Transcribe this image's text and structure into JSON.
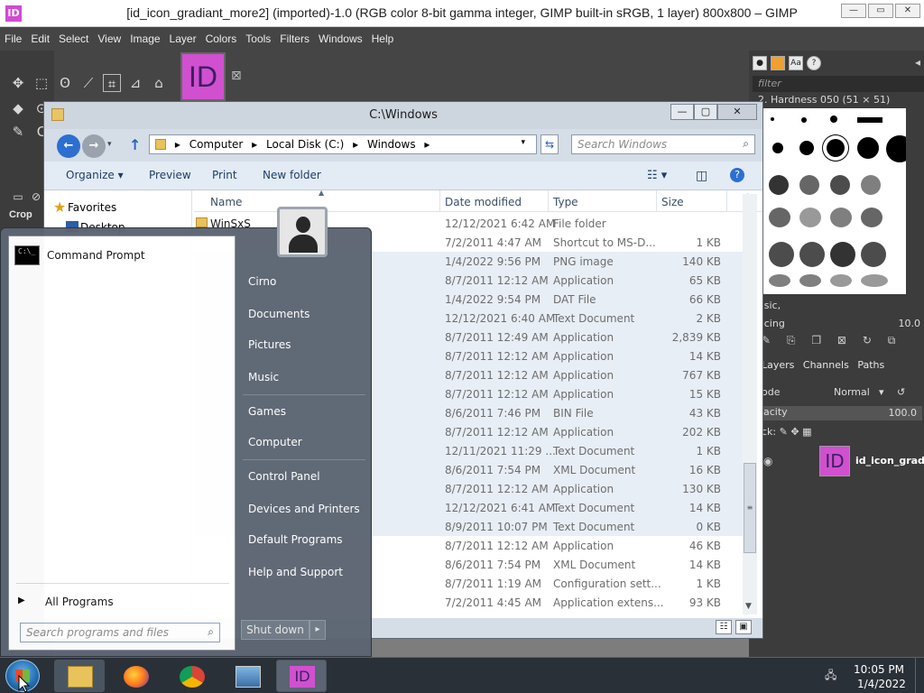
{
  "gimp": {
    "title": "[id_icon_gradiant_more2] (imported)-1.0 (RGB color 8-bit gamma integer, GIMP built-in sRGB, 1 layer) 800x800 – GIMP",
    "app_icon": "ID",
    "menu": [
      "File",
      "Edit",
      "Select",
      "View",
      "Image",
      "Layer",
      "Colors",
      "Tools",
      "Filters",
      "Windows",
      "Help"
    ],
    "crop_label": "Crop",
    "image_tab": "ID",
    "dock": {
      "filter_placeholder": "filter",
      "brush_name": "2. Hardness 050 (51 × 51)",
      "brush_mode": "asic,",
      "spacing_label": "acing",
      "spacing_value": "10.0",
      "tabs": [
        "Layers",
        "Channels",
        "Paths"
      ],
      "mode_label": "ode",
      "mode_value": "Normal",
      "opacity_label": "acity",
      "opacity_value": "100.0",
      "lock_label": "ck:",
      "layer_name": "id_icon_gradi",
      "layer_thumb": "ID"
    }
  },
  "explorer": {
    "title": "C:\\Windows",
    "breadcrumb": [
      "Computer",
      "Local Disk (C:)",
      "Windows"
    ],
    "search_placeholder": "Search Windows",
    "commands": [
      "Organize ▾",
      "Preview",
      "Print",
      "New folder"
    ],
    "nav": {
      "favorites": "Favorites",
      "desktop": "Desktop"
    },
    "columns": [
      "Name",
      "Date modified",
      "Type",
      "Size"
    ],
    "rows": [
      {
        "name": "WinSxS",
        "date": "12/12/2021 6:42 AM",
        "type": "File folder",
        "size": "",
        "folder": true
      },
      {
        "name": "",
        "date": "7/2/2011 4:47 AM",
        "type": "Shortcut to MS-D...",
        "size": "1 KB"
      },
      {
        "name": "",
        "date": "1/4/2022 9:56 PM",
        "type": "PNG image",
        "size": "140 KB"
      },
      {
        "name": "",
        "date": "8/7/2011 12:12 AM",
        "type": "Application",
        "size": "65 KB"
      },
      {
        "name": "",
        "date": "1/4/2022 9:54 PM",
        "type": "DAT File",
        "size": "66 KB"
      },
      {
        "name": "",
        "date": "12/12/2021 6:40 AM",
        "type": "Text Document",
        "size": "2 KB"
      },
      {
        "name": "",
        "date": "8/7/2011 12:49 AM",
        "type": "Application",
        "size": "2,839 KB"
      },
      {
        "name": "",
        "date": "8/7/2011 12:12 AM",
        "type": "Application",
        "size": "14 KB"
      },
      {
        "name": "",
        "date": "8/7/2011 12:12 AM",
        "type": "Application",
        "size": "767 KB"
      },
      {
        "name": "",
        "date": "8/7/2011 12:12 AM",
        "type": "Application",
        "size": "15 KB"
      },
      {
        "name": "",
        "date": "8/6/2011 7:46 PM",
        "type": "BIN File",
        "size": "43 KB"
      },
      {
        "name": "",
        "date": "8/7/2011 12:12 AM",
        "type": "Application",
        "size": "202 KB"
      },
      {
        "name": "",
        "date": "12/11/2021 11:29 ...",
        "type": "Text Document",
        "size": "1 KB"
      },
      {
        "name": "",
        "date": "8/6/2011 7:54 PM",
        "type": "XML Document",
        "size": "16 KB"
      },
      {
        "name": "",
        "date": "8/7/2011 12:12 AM",
        "type": "Application",
        "size": "130 KB"
      },
      {
        "name": "",
        "date": "12/12/2021 6:41 AM",
        "type": "Text Document",
        "size": "14 KB"
      },
      {
        "name": "",
        "date": "8/9/2011 10:07 PM",
        "type": "Text Document",
        "size": "0 KB"
      },
      {
        "name": "",
        "date": "8/7/2011 12:12 AM",
        "type": "Application",
        "size": "46 KB"
      },
      {
        "name": "",
        "date": "8/6/2011 7:54 PM",
        "type": "XML Document",
        "size": "14 KB"
      },
      {
        "name": "",
        "date": "8/7/2011 1:19 AM",
        "type": "Configuration sett...",
        "size": "1 KB"
      },
      {
        "name": "",
        "date": "7/2/2011 4:45 AM",
        "type": "Application extens...",
        "size": "93 KB"
      }
    ]
  },
  "start_menu": {
    "pinned": [
      {
        "label": "Command Prompt",
        "icon": "command-prompt-icon",
        "icon_text": "C:\\_"
      }
    ],
    "all_programs": "All Programs",
    "search_placeholder": "Search programs and files",
    "right_items": [
      "Cirno",
      "Documents",
      "Pictures",
      "Music",
      "Games",
      "Computer",
      "Control Panel",
      "Devices and Printers",
      "Default Programs",
      "Help and Support"
    ],
    "shutdown": "Shut down"
  },
  "taskbar": {
    "pinned": [
      "file-explorer-icon",
      "firefox-icon",
      "chrome-icon",
      "image-viewer-icon",
      "gimp-image-icon"
    ],
    "gimp_label": "ID",
    "clock_time": "10:05 PM",
    "clock_date": "1/4/2022"
  },
  "colors": {
    "gimp_bg": "#454545",
    "explorer_chrome": "#d5dde7",
    "selection_row": "#e8eef6",
    "start_menu_right": "#5c6572",
    "taskbar": "#2a3038",
    "id_icon_pink": "#d050d0"
  }
}
